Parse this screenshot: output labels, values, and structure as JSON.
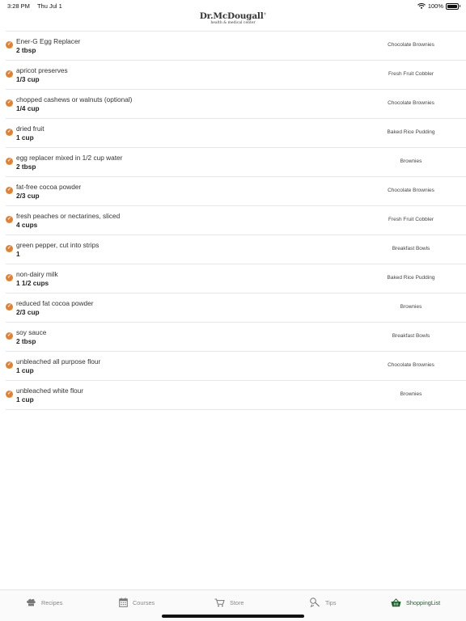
{
  "status": {
    "time": "3:28 PM",
    "date": "Thu Jul 1",
    "battery": "100%"
  },
  "header": {
    "logo_name": "Dr.McDougall",
    "logo_mark": "®",
    "logo_sub": "health & medical center"
  },
  "items": [
    {
      "ingredient": "Ener-G Egg Replacer",
      "quantity": "2 tbsp",
      "recipe": "Chocolate Brownies"
    },
    {
      "ingredient": "apricot preserves",
      "quantity": "1/3 cup",
      "recipe": "Fresh Fruit Cobbler"
    },
    {
      "ingredient": "chopped cashews or walnuts (optional)",
      "quantity": "1/4 cup",
      "recipe": "Chocolate Brownies"
    },
    {
      "ingredient": "dried fruit",
      "quantity": "1 cup",
      "recipe": "Baked Rice Pudding"
    },
    {
      "ingredient": "egg replacer mixed in 1/2 cup water",
      "quantity": "2 tbsp",
      "recipe": "Brownies"
    },
    {
      "ingredient": "fat-free cocoa powder",
      "quantity": "2/3 cup",
      "recipe": "Chocolate Brownies"
    },
    {
      "ingredient": "fresh peaches or nectarines, sliced",
      "quantity": "4 cups",
      "recipe": "Fresh Fruit Cobbler"
    },
    {
      "ingredient": "green pepper, cut into strips",
      "quantity": "1",
      "recipe": "Breakfast Bowls"
    },
    {
      "ingredient": "non-dairy milk",
      "quantity": "1 1/2 cups",
      "recipe": "Baked Rice Pudding"
    },
    {
      "ingredient": "reduced fat cocoa powder",
      "quantity": "2/3 cup",
      "recipe": "Brownies"
    },
    {
      "ingredient": "soy sauce",
      "quantity": "2 tbsp",
      "recipe": "Breakfast Bowls"
    },
    {
      "ingredient": "unbleached all purpose flour",
      "quantity": "1 cup",
      "recipe": "Chocolate Brownies"
    },
    {
      "ingredient": "unbleached white flour",
      "quantity": "1 cup",
      "recipe": "Brownies"
    }
  ],
  "tabs": [
    {
      "label": "Recipes",
      "icon": "chef-hat-icon"
    },
    {
      "label": "Courses",
      "icon": "calendar-icon"
    },
    {
      "label": "Store",
      "icon": "cart-icon"
    },
    {
      "label": "Tips",
      "icon": "tips-icon"
    },
    {
      "label": "ShoppingList",
      "icon": "basket-icon",
      "active": true
    }
  ],
  "colors": {
    "check": "#ea7f2a",
    "active_tab": "#1f5e2c"
  }
}
